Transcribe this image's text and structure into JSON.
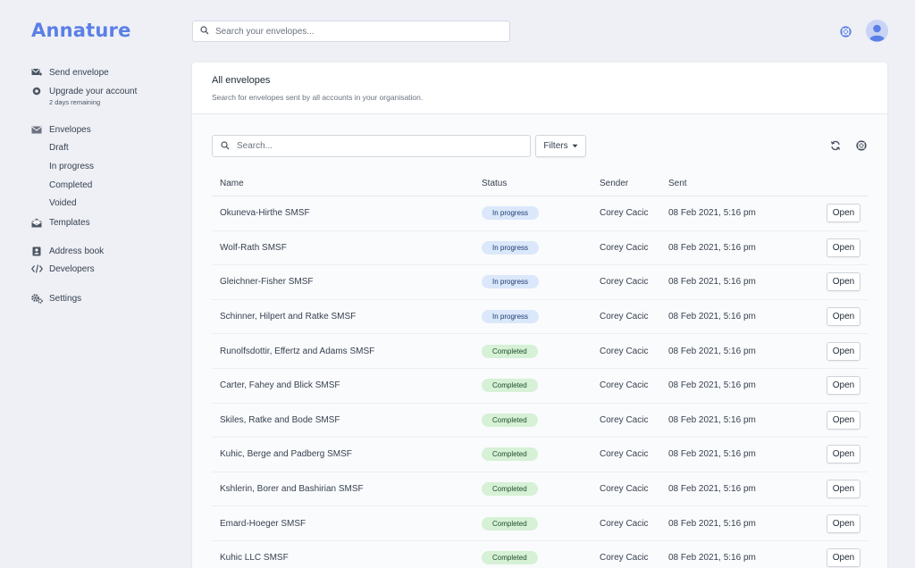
{
  "app": {
    "logo": "Annature"
  },
  "top_search": {
    "placeholder": "Search your envelopes..."
  },
  "sidebar": {
    "send_envelope": "Send envelope",
    "upgrade": "Upgrade your account",
    "upgrade_note": "2 days remaining",
    "envelopes": "Envelopes",
    "draft": "Draft",
    "in_progress": "In progress",
    "completed": "Completed",
    "voided": "Voided",
    "templates": "Templates",
    "address_book": "Address book",
    "developers": "Developers",
    "settings": "Settings"
  },
  "main": {
    "title": "All envelopes",
    "subtitle": "Search for envelopes sent by all accounts in your organisation.",
    "search_placeholder": "Search...",
    "filters_label": "Filters",
    "columns": {
      "name": "Name",
      "status": "Status",
      "sender": "Sender",
      "sent": "Sent"
    },
    "rows": [
      {
        "name": "Okuneva-Hirthe SMSF",
        "status": "In progress",
        "status_type": "progress",
        "sender": "Corey Cacic",
        "sent": "08 Feb 2021, 5:16 pm",
        "action": "Open"
      },
      {
        "name": "Wolf-Rath SMSF",
        "status": "In progress",
        "status_type": "progress",
        "sender": "Corey Cacic",
        "sent": "08 Feb 2021, 5:16 pm",
        "action": "Open"
      },
      {
        "name": "Gleichner-Fisher SMSF",
        "status": "In progress",
        "status_type": "progress",
        "sender": "Corey Cacic",
        "sent": "08 Feb 2021, 5:16 pm",
        "action": "Open"
      },
      {
        "name": "Schinner, Hilpert and Ratke SMSF",
        "status": "In progress",
        "status_type": "progress",
        "sender": "Corey Cacic",
        "sent": "08 Feb 2021, 5:16 pm",
        "action": "Open"
      },
      {
        "name": "Runolfsdottir, Effertz and Adams SMSF",
        "status": "Completed",
        "status_type": "completed",
        "sender": "Corey Cacic",
        "sent": "08 Feb 2021, 5:16 pm",
        "action": "Open"
      },
      {
        "name": "Carter, Fahey and Blick SMSF",
        "status": "Completed",
        "status_type": "completed",
        "sender": "Corey Cacic",
        "sent": "08 Feb 2021, 5:16 pm",
        "action": "Open"
      },
      {
        "name": "Skiles, Ratke and Bode SMSF",
        "status": "Completed",
        "status_type": "completed",
        "sender": "Corey Cacic",
        "sent": "08 Feb 2021, 5:16 pm",
        "action": "Open"
      },
      {
        "name": "Kuhic, Berge and Padberg SMSF",
        "status": "Completed",
        "status_type": "completed",
        "sender": "Corey Cacic",
        "sent": "08 Feb 2021, 5:16 pm",
        "action": "Open"
      },
      {
        "name": "Kshlerin, Borer and Bashirian SMSF",
        "status": "Completed",
        "status_type": "completed",
        "sender": "Corey Cacic",
        "sent": "08 Feb 2021, 5:16 pm",
        "action": "Open"
      },
      {
        "name": "Emard-Hoeger SMSF",
        "status": "Completed",
        "status_type": "completed",
        "sender": "Corey Cacic",
        "sent": "08 Feb 2021, 5:16 pm",
        "action": "Open"
      },
      {
        "name": "Kuhic LLC SMSF",
        "status": "Completed",
        "status_type": "completed",
        "sender": "Corey Cacic",
        "sent": "08 Feb 2021, 5:16 pm",
        "action": "Open"
      }
    ]
  },
  "icons": {
    "search": "search-icon",
    "help": "help-icon",
    "refresh": "refresh-icon",
    "send": "send-envelope-icon",
    "upgrade": "upgrade-icon",
    "envelopes": "envelopes-icon",
    "templates": "templates-icon",
    "address_book": "address-book-icon",
    "developers": "code-icon",
    "settings": "gear-icon"
  },
  "colors": {
    "brand": "#5b7fe6",
    "in_progress_badge": "#dbe8fb",
    "completed_badge": "#d6f1d6"
  }
}
